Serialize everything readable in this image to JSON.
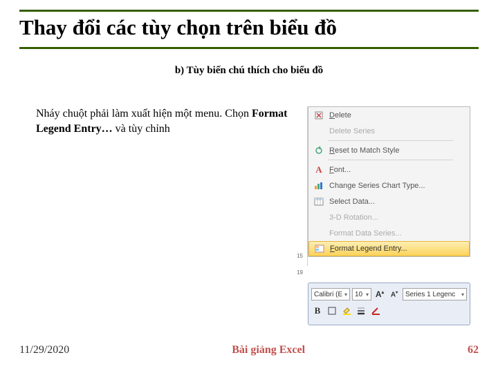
{
  "title": "Thay đổi các tùy chọn trên biểu đồ",
  "subtitle": "b) Tùy biến chú thích cho biểu đồ",
  "body_prefix": "Nháy chuột phải làm xuất hiện một menu. Chọn ",
  "body_strong": "Format Legend Entry…",
  "body_suffix": " và tùy chỉnh",
  "menu": {
    "items": [
      {
        "icon": "delete",
        "label": "Delete",
        "u": "D",
        "rest": "elete"
      },
      {
        "icon": "",
        "label": "Delete Series",
        "u": "",
        "rest": "Delete Series",
        "disabled": true
      },
      {
        "sep": true
      },
      {
        "icon": "reset",
        "label": "Reset to Match Style",
        "u": "R",
        "rest": "eset to Match Style"
      },
      {
        "sep": true
      },
      {
        "icon": "font",
        "label": "Font...",
        "u": "F",
        "rest": "ont..."
      },
      {
        "icon": "chart",
        "label": "Change Series Chart Type...",
        "u": "",
        "rest": "Change Series Chart Type..."
      },
      {
        "icon": "select",
        "label": "Select Data...",
        "u": "",
        "rest": "Select Data..."
      },
      {
        "icon": "",
        "label": "3-D Rotation...",
        "u": "",
        "rest": "3-D Rotation...",
        "disabled": true
      },
      {
        "icon": "",
        "label": "Format Data Series...",
        "u": "",
        "rest": "Format Data Series...",
        "disabled": true
      },
      {
        "icon": "format",
        "label": "Format Legend Entry...",
        "u": "F",
        "rest": "ormat Legend Entry...",
        "hl": true
      }
    ]
  },
  "toolbar": {
    "font": "Calibri (E",
    "size": "10",
    "series": "Series 1 Legenc",
    "bold": "B",
    "grow": "A",
    "shrink": "A"
  },
  "nums": {
    "a": "15",
    "b": "19"
  },
  "footer": {
    "date": "11/29/2020",
    "title": "Bài giảng Excel",
    "page": "62"
  }
}
